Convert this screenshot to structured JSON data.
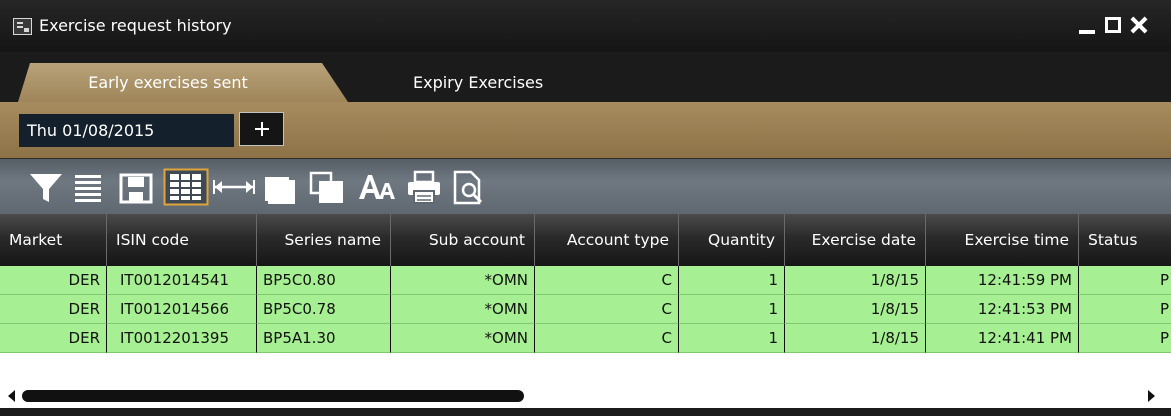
{
  "window": {
    "title": "Exercise request history",
    "controls": [
      "minimize-icon",
      "maximize-icon",
      "close-icon"
    ]
  },
  "tabs": [
    {
      "label": "Early exercises sent",
      "active": true
    },
    {
      "label": "Expiry Exercises",
      "active": false
    }
  ],
  "filter": {
    "date_value": "Thu 01/08/2015",
    "add_icon": "plus-icon"
  },
  "toolbar": {
    "icons": [
      "filter-icon",
      "list-icon",
      "save-icon",
      "columns-icon",
      "fit-width-icon",
      "window-front-icon",
      "window-cascade-icon",
      "font-size-icon",
      "print-icon",
      "print-preview-icon"
    ]
  },
  "table": {
    "columns": [
      "Market",
      "ISIN code",
      "Series name",
      "Sub account",
      "Account type",
      "Quantity",
      "Exercise date",
      "Exercise time",
      "Status"
    ],
    "rows": [
      [
        "DER",
        "IT0012014541",
        "BP5C0.80",
        "*OMN",
        "C",
        "1",
        "1/8/15",
        "12:41:59 PM",
        "P"
      ],
      [
        "DER",
        "IT0012014566",
        "BP5C0.78",
        "*OMN",
        "C",
        "1",
        "1/8/15",
        "12:41:53 PM",
        "P"
      ],
      [
        "DER",
        "IT0012201395",
        "BP5A1.30",
        "*OMN",
        "C",
        "1",
        "1/8/15",
        "12:41:41 PM",
        "P"
      ]
    ],
    "row_color": "#a6ef92"
  },
  "colors": {
    "tab_gold": "#b9a279",
    "toolbar_gray": "#6f7881",
    "accent_orange": "#e0a43a"
  }
}
